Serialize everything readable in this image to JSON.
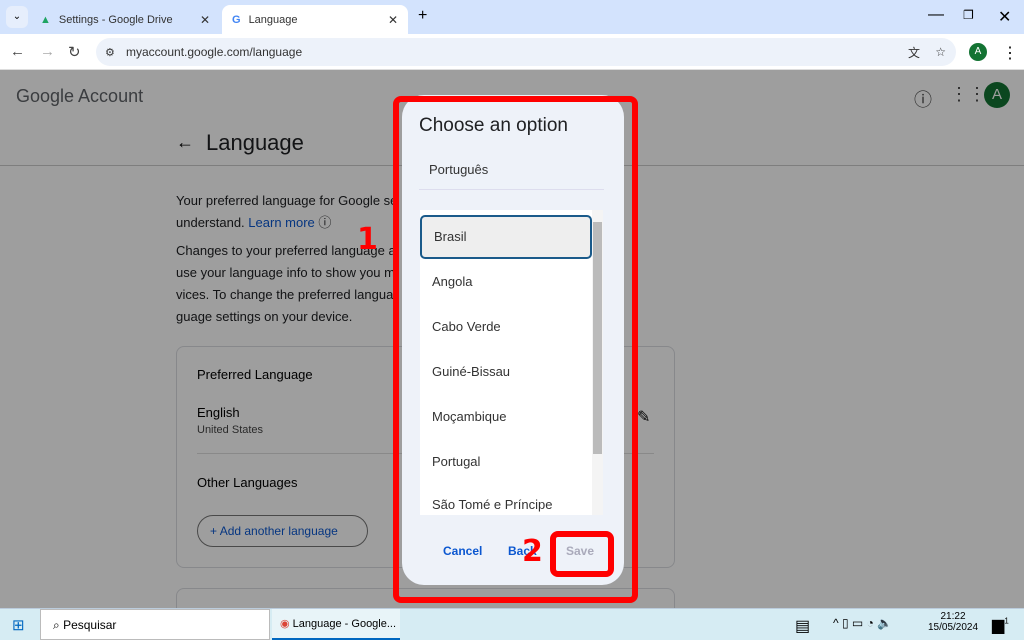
{
  "browser": {
    "tabs": [
      {
        "title": "Settings - Google Drive"
      },
      {
        "title": "Language"
      }
    ],
    "url": "myaccount.google.com/language",
    "profile_initial": "A"
  },
  "header": {
    "logo": "Google Account",
    "avatar": "A"
  },
  "page": {
    "title": "Language",
    "para1": [
      "Your preferred language for Google se",
      "understand."
    ],
    "learn_more": "Learn more",
    "para2": [
      "Changes to your preferred language a",
      "use your language info to show you m",
      "vices. To change the preferred langua",
      "guage settings on your device."
    ],
    "preferred": {
      "heading": "Preferred Language",
      "language": "English",
      "region": "United States"
    },
    "other": {
      "heading": "Other Languages",
      "add_button": "Add another language"
    }
  },
  "dialog": {
    "title": "Choose an option",
    "language": "Português",
    "options": [
      "Brasil",
      "Angola",
      "Cabo Verde",
      "Guiné-Bissau",
      "Moçambique",
      "Portugal",
      "São Tomé e Príncipe"
    ],
    "selected": "Brasil",
    "cancel": "Cancel",
    "back": "Back",
    "save": "Save"
  },
  "annotations": [
    "1",
    "2"
  ],
  "taskbar": {
    "search": "Pesquisar",
    "app": "Language - Google...",
    "time": "21:22",
    "date": "15/05/2024",
    "notifications": "1"
  },
  "colors": {
    "highlight": "#ff0000",
    "accent": "#0b57d0",
    "avatar": "#137333"
  }
}
